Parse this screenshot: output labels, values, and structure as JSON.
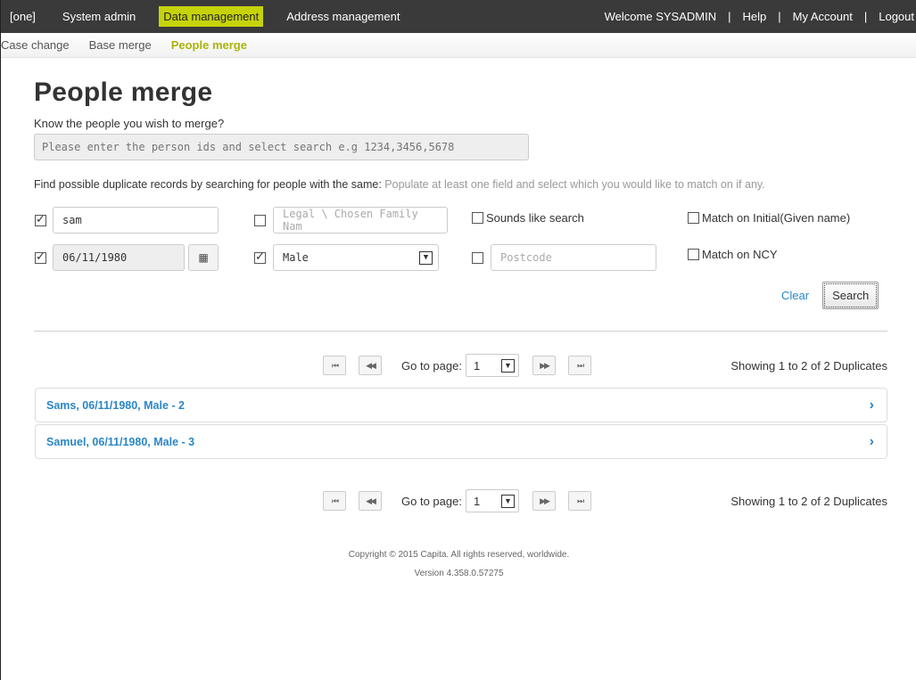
{
  "topbar": {
    "left_items": [
      "[one]",
      "System admin",
      "Data management",
      "Address management"
    ],
    "active_index": 2,
    "welcome": "Welcome SYSADMIN",
    "help": "Help",
    "account": "My Account",
    "logout": "Logout",
    "separator": "|"
  },
  "subnav": {
    "items": [
      "Case change",
      "Base merge",
      "People merge"
    ],
    "active_index": 2
  },
  "page": {
    "title": "People merge",
    "ids_prompt": "Know the people you wish to merge?",
    "ids_placeholder": "Please enter the person ids and select search e.g 1234,3456,5678",
    "find_text": "Find possible duplicate records by searching for people with the same:",
    "find_hint": "Populate at least one field and select which you would like to match on if any."
  },
  "form": {
    "name": {
      "checked": true,
      "value": "sam"
    },
    "family_name": {
      "checked": false,
      "placeholder": "Legal \\ Chosen Family Nam"
    },
    "sounds_like": {
      "checked": false,
      "label": "Sounds like search"
    },
    "match_initial": {
      "checked": false,
      "label": "Match on Initial(Given name)"
    },
    "dob": {
      "checked": true,
      "value": "06/11/1980",
      "calendar_icon": "▦"
    },
    "gender": {
      "checked": true,
      "value": "Male"
    },
    "postcode": {
      "checked": false,
      "placeholder": "Postcode"
    },
    "match_ncy": {
      "checked": false,
      "label": "Match on NCY"
    },
    "clear_label": "Clear",
    "search_label": "Search"
  },
  "pager": {
    "first": "⏮",
    "prev": "◀◀",
    "next": "▶▶",
    "last": "⏭",
    "goto_label": "Go to page:",
    "page": "1",
    "showing": "Showing 1 to 2 of 2 Duplicates"
  },
  "results": [
    {
      "label": "Sams, 06/11/1980, Male - 2"
    },
    {
      "label": "Samuel, 06/11/1980, Male - 3"
    }
  ],
  "footer": {
    "copyright": "Copyright © 2015 Capita. All rights reserved, worldwide.",
    "version": "Version 4.358.0.57275"
  }
}
